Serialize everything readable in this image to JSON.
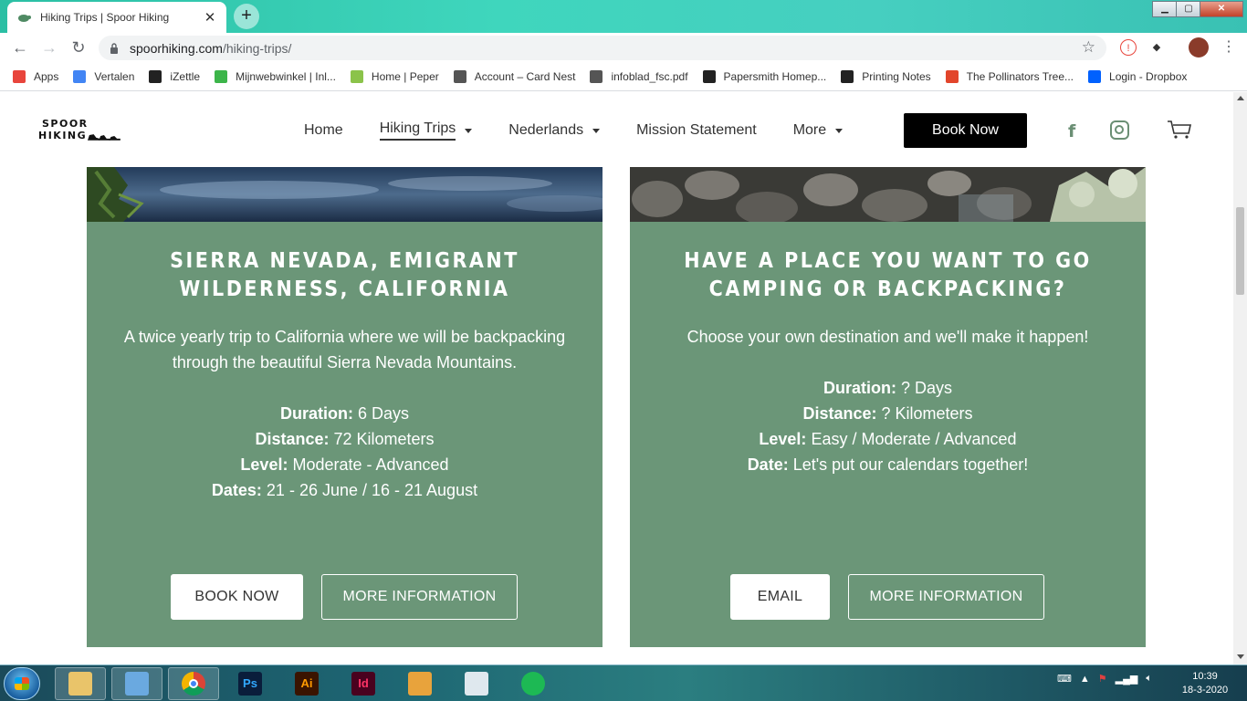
{
  "browser": {
    "tab_title": "Hiking Trips | Spoor Hiking",
    "tab_close": "✕",
    "new_tab": "+",
    "url_domain": "spoorhiking.com",
    "url_path": "/hiking-trips/",
    "bookmarks": [
      {
        "label": "Apps",
        "icon": "apps-grid-icon",
        "color": "#e8453c"
      },
      {
        "label": "Vertalen",
        "icon": "translate-icon",
        "color": "#4285f4"
      },
      {
        "label": "iZettle",
        "icon": "izettle-icon",
        "color": "#222222"
      },
      {
        "label": "Mijnwebwinkel | Inl...",
        "icon": "mijnwebwinkel-icon",
        "color": "#3cb54a"
      },
      {
        "label": "Home | Peper",
        "icon": "peper-icon",
        "color": "#8bc34a"
      },
      {
        "label": "Account – Card Nest",
        "icon": "cardnest-icon",
        "color": "#555555"
      },
      {
        "label": "infoblad_fsc.pdf",
        "icon": "globe-icon",
        "color": "#555555"
      },
      {
        "label": "Papersmith Homep...",
        "icon": "papersmith-icon",
        "color": "#222222"
      },
      {
        "label": "Printing Notes",
        "icon": "printing-notes-icon",
        "color": "#222222"
      },
      {
        "label": "The Pollinators Tree...",
        "icon": "pollinators-icon",
        "color": "#e2452b"
      },
      {
        "label": "Login - Dropbox",
        "icon": "dropbox-icon",
        "color": "#0061fe"
      }
    ]
  },
  "site": {
    "logo_line1": "SPOOR",
    "logo_line2": "HIKING",
    "nav": [
      {
        "label": "Home",
        "dropdown": false,
        "active": false
      },
      {
        "label": "Hiking Trips",
        "dropdown": true,
        "active": true
      },
      {
        "label": "Nederlands",
        "dropdown": true,
        "active": false
      },
      {
        "label": "Mission Statement",
        "dropdown": false,
        "active": false
      },
      {
        "label": "More",
        "dropdown": true,
        "active": false
      }
    ],
    "book_now": "Book Now",
    "accent": "#6b9678",
    "icon_color": "#6b8f74"
  },
  "cards": [
    {
      "title": "Sierra Nevada, Emigrant Wilderness, California",
      "description": "A twice yearly trip to California where we will be backpacking through the beautiful Sierra Nevada Mountains.",
      "details": [
        {
          "label": "Duration:",
          "value": " 6 Days"
        },
        {
          "label": "Distance:",
          "value": " 72 Kilometers"
        },
        {
          "label": "Level:",
          "value": " Moderate - Advanced"
        },
        {
          "label": "Dates:",
          "value": " 21 - 26 June / 16 - 21 August"
        }
      ],
      "btn_primary": "BOOK NOW",
      "btn_secondary": "MORE INFORMATION"
    },
    {
      "title": "Have a place you want to go camping or backpacking?",
      "description": "Choose your own destination and we'll make it happen!",
      "details": [
        {
          "label": "Duration:",
          "value": " ? Days"
        },
        {
          "label": "Distance:",
          "value": " ? Kilometers"
        },
        {
          "label": "Level:",
          "value": " Easy / Moderate / Advanced"
        },
        {
          "label": "Date:",
          "value": " Let's put our calendars together!"
        }
      ],
      "btn_primary": "EMAIL",
      "btn_secondary": "MORE INFORMATION"
    }
  ],
  "taskbar": {
    "apps": [
      {
        "name": "explorer",
        "label": "",
        "bg": "#e9c46a",
        "fg": "#5b3d00"
      },
      {
        "name": "mail",
        "label": "",
        "bg": "#6aa9e0",
        "fg": "#ffffff"
      },
      {
        "name": "chrome",
        "label": "",
        "bg": "#ffffff",
        "fg": "#ffffff"
      },
      {
        "name": "photoshop",
        "label": "Ps",
        "bg": "#0a1d3b",
        "fg": "#31a8ff"
      },
      {
        "name": "illustrator",
        "label": "Ai",
        "bg": "#3a1400",
        "fg": "#ff9a00"
      },
      {
        "name": "indesign",
        "label": "Id",
        "bg": "#49021f",
        "fg": "#ff3366"
      },
      {
        "name": "paint",
        "label": "",
        "bg": "#e8a33c",
        "fg": "#ffffff"
      },
      {
        "name": "calculator",
        "label": "",
        "bg": "#dfe8ee",
        "fg": "#333333"
      },
      {
        "name": "spotify",
        "label": "",
        "bg": "#1db954",
        "fg": "#000000"
      }
    ],
    "time": "10:39",
    "date": "18-3-2020"
  }
}
